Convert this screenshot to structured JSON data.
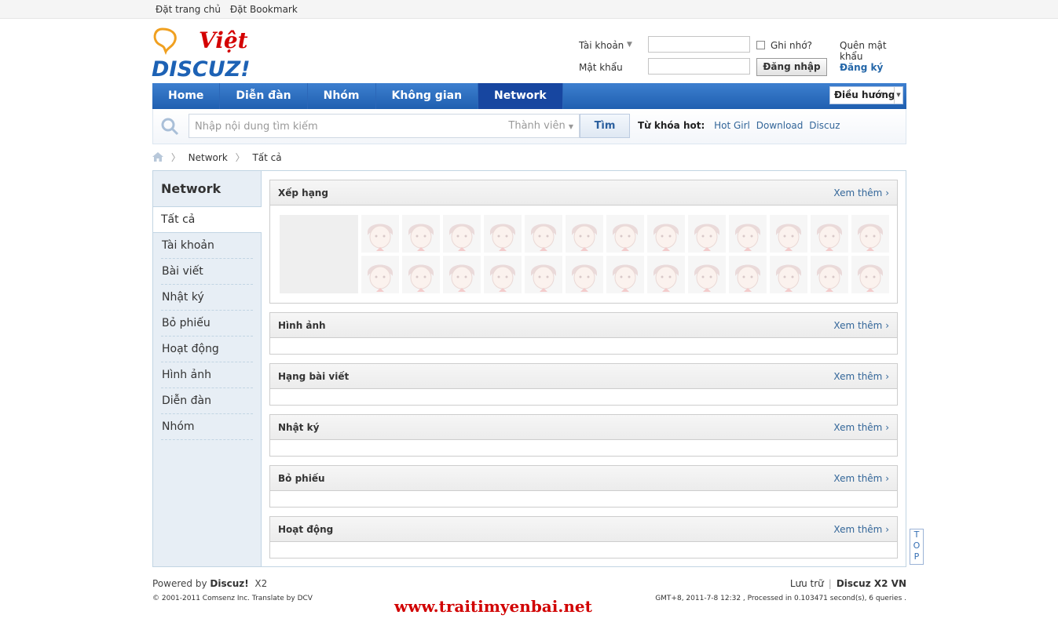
{
  "topbar": {
    "set_home": "Đặt trang chủ",
    "bookmark": "Đặt Bookmark"
  },
  "logo": {
    "main": "DISCUZ!",
    "accent": "Việt"
  },
  "login": {
    "account_label": "Tài khoản",
    "password_label": "Mật khẩu",
    "remember": "Ghi nhớ?",
    "forgot": "Quên mật khẩu",
    "login_btn": "Đăng nhập",
    "register": "Đăng ký"
  },
  "nav": {
    "items": [
      "Home",
      "Diễn đàn",
      "Nhóm",
      "Không gian",
      "Network"
    ],
    "active": "Network",
    "jump": "Điều hướng"
  },
  "search": {
    "placeholder": "Nhập nội dung tìm kiếm",
    "scope": "Thành viên",
    "button": "Tìm",
    "hot_label": "Từ khóa hot:",
    "hot": [
      "Hot Girl",
      "Download",
      "Discuz"
    ]
  },
  "breadcrumb": [
    "Network",
    "Tất cả"
  ],
  "sidebar": {
    "title": "Network",
    "current": "Tất cả",
    "items": [
      "Tài khoản",
      "Bài viết",
      "Nhật ký",
      "Bỏ phiếu",
      "Hoạt động",
      "Hình ảnh",
      "Diễn đàn",
      "Nhóm"
    ]
  },
  "panels": [
    {
      "title": "Xếp hạng",
      "more": "Xem thêm ›"
    },
    {
      "title": "Hình ảnh",
      "more": "Xem thêm ›"
    },
    {
      "title": "Hạng bài viết",
      "more": "Xem thêm ›"
    },
    {
      "title": "Nhật ký",
      "more": "Xem thêm ›"
    },
    {
      "title": "Bỏ phiếu",
      "more": "Xem thêm ›"
    },
    {
      "title": "Hoạt động",
      "more": "Xem thêm ›"
    }
  ],
  "top_button": "TOP",
  "footer": {
    "powered": "Powered by",
    "brand": "Discuz!",
    "version": "X2",
    "copyright": "© 2001-2011",
    "company": "Comsenz Inc.",
    "translate": "Translate by",
    "translator": "DCV",
    "archive": "Lưu trữ",
    "edition": "Discuz X2 VN",
    "stats": "GMT+8, 2011-7-8 12:32 , Processed in 0.103471 second(s), 6 queries ."
  },
  "watermark": "www.traitimyenbai.net"
}
